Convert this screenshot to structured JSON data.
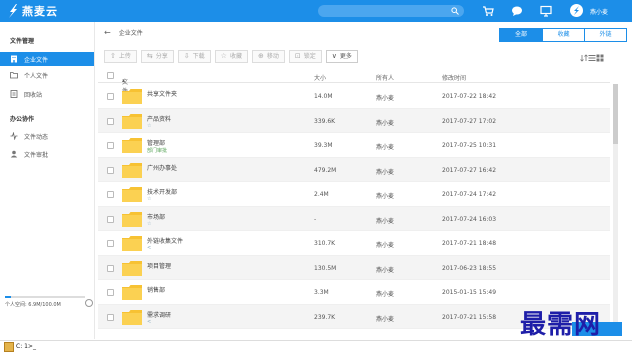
{
  "app": {
    "name": "燕麦云",
    "username": "燕小麦",
    "brand_color": "#1c8ee8"
  },
  "sidebar": {
    "section1": "文件管理",
    "items": [
      {
        "label": "企业文件",
        "icon": "building-icon",
        "active": true
      },
      {
        "label": "个人文件",
        "icon": "folder-outline-icon",
        "active": false
      },
      {
        "label": "回收站",
        "icon": "trash-icon",
        "active": false
      }
    ],
    "section2": "办公协作",
    "items2": [
      {
        "label": "文件动态",
        "icon": "activity-icon"
      },
      {
        "label": "文件审批",
        "icon": "user-check-icon"
      }
    ],
    "quota_text": "个人空间: 6.9M/100.0M",
    "quota_used_fraction": 0.069
  },
  "breadcrumb": {
    "current": "企业文件"
  },
  "tabs": [
    {
      "label": "全部",
      "active": true
    },
    {
      "label": "收藏",
      "active": false
    },
    {
      "label": "外链",
      "active": false
    }
  ],
  "toolbar": {
    "upload": "上传",
    "share": "分享",
    "download": "下载",
    "favorite": "收藏",
    "move": "移动",
    "lock": "锁定",
    "more": "更多"
  },
  "table": {
    "headers": {
      "name": "文件名",
      "size": "大小",
      "owner": "所有人",
      "modified": "修改时间"
    },
    "rows": [
      {
        "name": "共享文件夹",
        "sub": "",
        "size": "14.0M",
        "owner": "燕小麦",
        "time": "2017-07-22 18:42"
      },
      {
        "name": "产品资料",
        "sub": "☆",
        "size": "339.6K",
        "owner": "燕小麦",
        "time": "2017-07-27 17:02"
      },
      {
        "name": "管理部",
        "sub": "部门审批",
        "size": "39.3M",
        "owner": "燕小麦",
        "time": "2017-07-25 10:31"
      },
      {
        "name": "广州办事处",
        "sub": "",
        "size": "479.2M",
        "owner": "燕小麦",
        "time": "2017-07-27 16:42"
      },
      {
        "name": "技术开发部",
        "sub": "☆",
        "size": "2.4M",
        "owner": "燕小麦",
        "time": "2017-07-24 17:42"
      },
      {
        "name": "市场部",
        "sub": "☆",
        "size": "-",
        "owner": "燕小麦",
        "time": "2017-07-24 16:03"
      },
      {
        "name": "外链收集文件",
        "sub": "<",
        "size": "310.7K",
        "owner": "燕小麦",
        "time": "2017-07-21 18:48"
      },
      {
        "name": "项目管理",
        "sub": "",
        "size": "130.5M",
        "owner": "燕小麦",
        "time": "2017-06-23 18:55"
      },
      {
        "name": "销售部",
        "sub": "",
        "size": "3.3M",
        "owner": "燕小麦",
        "time": "2015-01-15 15:49"
      },
      {
        "name": "需求调研",
        "sub": "<",
        "size": "239.7K",
        "owner": "燕小麦",
        "time": "2017-07-21 15:58"
      }
    ]
  },
  "watermark": "最需网",
  "taskbar": {
    "label": "C: 1>_"
  }
}
